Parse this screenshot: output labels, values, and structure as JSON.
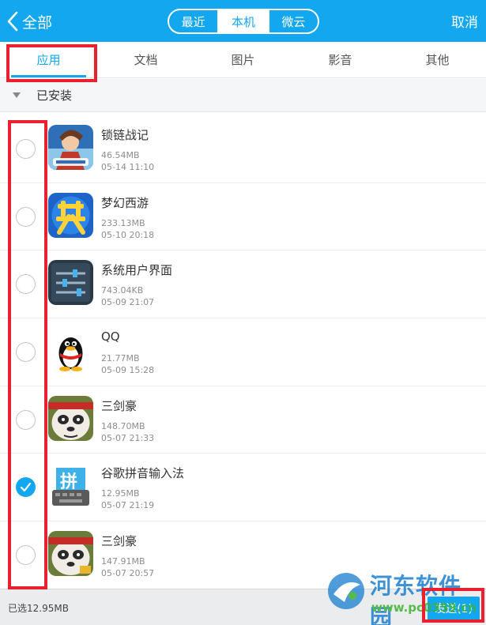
{
  "header": {
    "back_label": "全部",
    "segments": [
      "最近",
      "本机",
      "微云"
    ],
    "active_segment": "本机",
    "cancel_label": "取消",
    "accent_color": "#12a7ee"
  },
  "category_tabs": [
    {
      "label": "应用",
      "active": true
    },
    {
      "label": "文档",
      "active": false
    },
    {
      "label": "图片",
      "active": false
    },
    {
      "label": "影音",
      "active": false
    },
    {
      "label": "其他",
      "active": false
    }
  ],
  "section": {
    "label": "已安装",
    "expanded": true
  },
  "apps": [
    {
      "name": "锁链战记",
      "size": "46.54MB",
      "date": "05-14 11:10",
      "checked": false,
      "icon": "game-anime-warrior-icon"
    },
    {
      "name": "梦幻西游",
      "size": "233.13MB",
      "date": "05-10 20:18",
      "checked": false,
      "icon": "dream-glyph-icon"
    },
    {
      "name": "系统用户界面",
      "size": "743.04KB",
      "date": "05-09 21:07",
      "checked": false,
      "icon": "sliders-icon"
    },
    {
      "name": "QQ",
      "size": "21.77MB",
      "date": "05-09 15:28",
      "checked": false,
      "icon": "penguin-icon"
    },
    {
      "name": "三剑豪",
      "size": "148.70MB",
      "date": "05-07 21:33",
      "checked": false,
      "icon": "panda-warrior-icon"
    },
    {
      "name": "谷歌拼音输入法",
      "size": "12.95MB",
      "date": "05-07 21:19",
      "checked": true,
      "icon": "keyboard-pinyin-icon",
      "icon_text": "拼"
    },
    {
      "name": "三剑豪",
      "size": "147.91MB",
      "date": "05-07 20:57",
      "checked": false,
      "icon": "panda-warrior-icon"
    }
  ],
  "footer": {
    "selected_text": "已选12.95MB",
    "confirm_label": "发送(1)"
  },
  "watermark": {
    "title": "河东软件园",
    "url": "www.pc0359.cn"
  }
}
